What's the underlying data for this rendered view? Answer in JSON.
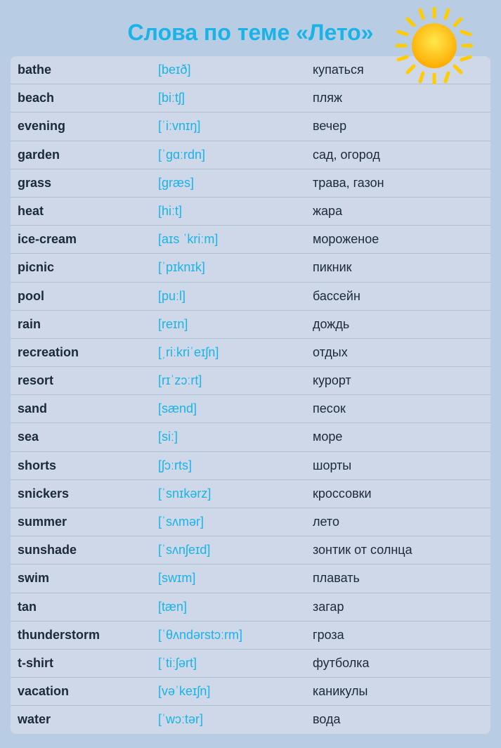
{
  "header": {
    "title": "Слова по теме «Лето»"
  },
  "vocab": [
    {
      "word": "bathe",
      "transcription": "[beɪð]",
      "meaning": "купаться"
    },
    {
      "word": "beach",
      "transcription": "[biːtʃ]",
      "meaning": "пляж"
    },
    {
      "word": "evening",
      "transcription": "[ˈiːvnɪŋ]",
      "meaning": "вечер"
    },
    {
      "word": "garden",
      "transcription": "[ˈɡɑːrdn]",
      "meaning": "сад, огород"
    },
    {
      "word": "grass",
      "transcription": "[ɡræs]",
      "meaning": "трава, газон"
    },
    {
      "word": "heat",
      "transcription": "[hiːt]",
      "meaning": "жара"
    },
    {
      "word": "ice-cream",
      "transcription": "[aɪs ˈkriːm]",
      "meaning": "мороженое"
    },
    {
      "word": "picnic",
      "transcription": "[ˈpɪknɪk]",
      "meaning": "пикник"
    },
    {
      "word": "pool",
      "transcription": "[puːl]",
      "meaning": "бассейн"
    },
    {
      "word": "rain",
      "transcription": "[reɪn]",
      "meaning": "дождь"
    },
    {
      "word": "recreation",
      "transcription": "[ˌriːkriˈeɪʃn]",
      "meaning": "отдых"
    },
    {
      "word": "resort",
      "transcription": "[rɪˈzɔːrt]",
      "meaning": "курорт"
    },
    {
      "word": "sand",
      "transcription": "[sænd]",
      "meaning": "песок"
    },
    {
      "word": "sea",
      "transcription": "[siː]",
      "meaning": "море"
    },
    {
      "word": "shorts",
      "transcription": "[ʃɔːrts]",
      "meaning": "шорты"
    },
    {
      "word": "snickers",
      "transcription": "[ˈsnɪkərz]",
      "meaning": "кроссовки"
    },
    {
      "word": "summer",
      "transcription": "[ˈsʌmər]",
      "meaning": "лето"
    },
    {
      "word": "sunshade",
      "transcription": "[ˈsʌnʃeɪd]",
      "meaning": "зонтик от солнца"
    },
    {
      "word": "swim",
      "transcription": "[swɪm]",
      "meaning": "плавать"
    },
    {
      "word": "tan",
      "transcription": "[tæn]",
      "meaning": "загар"
    },
    {
      "word": "thunderstorm",
      "transcription": "[ˈθʌndərstɔːrm]",
      "meaning": "гроза"
    },
    {
      "word": "t-shirt",
      "transcription": "[ˈtiːʃərt]",
      "meaning": "футболка"
    },
    {
      "word": "vacation",
      "transcription": "[vəˈkeɪʃn]",
      "meaning": "каникулы"
    },
    {
      "word": "water",
      "transcription": "[ˈwɔːtər]",
      "meaning": "вода"
    }
  ]
}
